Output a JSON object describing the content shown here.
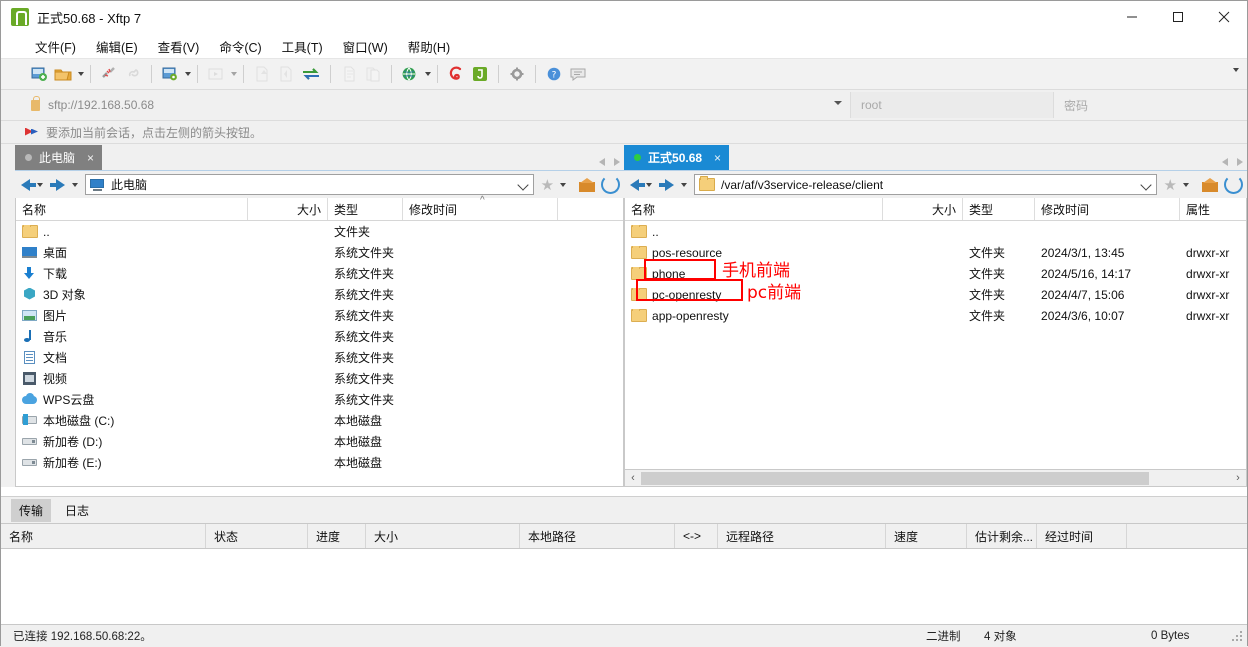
{
  "window": {
    "title": "正式50.68 - Xftp 7",
    "minimize": "—",
    "maximize": "▢",
    "close": "✕"
  },
  "menu": [
    "文件(F)",
    "编辑(E)",
    "查看(V)",
    "命令(C)",
    "工具(T)",
    "窗口(W)",
    "帮助(H)"
  ],
  "toolbar": {
    "icons": [
      "new-session-icon",
      "open-folder-icon",
      "disconnect-icon",
      "link-icon",
      "properties-icon",
      "run-icon",
      "transfer-left-icon",
      "transfer-right-icon",
      "sync-icon",
      "copy-icon",
      "paste-icon",
      "browser-icon",
      "xshell-icon",
      "xftp-icon",
      "settings-icon",
      "help-icon",
      "feedback-icon"
    ],
    "overflow": "chevron-down-icon"
  },
  "address": {
    "lock_icon": "lock-icon",
    "url": "sftp://192.168.50.68",
    "url_dropdown": "chevron-down-icon",
    "user_placeholder": "root",
    "password_placeholder": "密码"
  },
  "notice": {
    "icon": "arrows-icon",
    "text": "要添加当前会话，点击左侧的箭头按钮。"
  },
  "left_pane": {
    "tab": {
      "label": "此电脑",
      "close": "×",
      "dot": "status-dot"
    },
    "path": "此电脑",
    "path_icon": "pc-icon",
    "columns": [
      {
        "key": "name",
        "label": "名称"
      },
      {
        "key": "size",
        "label": "大小"
      },
      {
        "key": "type",
        "label": "类型"
      },
      {
        "key": "mtime",
        "label": "修改时间"
      }
    ],
    "sort_marker": "^",
    "rows": [
      {
        "icon": "folder-icon",
        "name": "..",
        "size": "",
        "type": "文件夹",
        "mtime": ""
      },
      {
        "icon": "desktop-icon",
        "name": "桌面",
        "size": "",
        "type": "系统文件夹",
        "mtime": ""
      },
      {
        "icon": "download-icon",
        "name": "下载",
        "size": "",
        "type": "系统文件夹",
        "mtime": ""
      },
      {
        "icon": "cube-icon",
        "name": "3D 对象",
        "size": "",
        "type": "系统文件夹",
        "mtime": ""
      },
      {
        "icon": "picture-icon",
        "name": "图片",
        "size": "",
        "type": "系统文件夹",
        "mtime": ""
      },
      {
        "icon": "music-icon",
        "name": "音乐",
        "size": "",
        "type": "系统文件夹",
        "mtime": ""
      },
      {
        "icon": "document-icon",
        "name": "文档",
        "size": "",
        "type": "系统文件夹",
        "mtime": ""
      },
      {
        "icon": "video-icon",
        "name": "视频",
        "size": "",
        "type": "系统文件夹",
        "mtime": ""
      },
      {
        "icon": "cloud-icon",
        "name": "WPS云盘",
        "size": "",
        "type": "系统文件夹",
        "mtime": ""
      },
      {
        "icon": "disk-c-icon",
        "name": "本地磁盘 (C:)",
        "size": "",
        "type": "本地磁盘",
        "mtime": ""
      },
      {
        "icon": "disk-icon",
        "name": "新加卷 (D:)",
        "size": "",
        "type": "本地磁盘",
        "mtime": ""
      },
      {
        "icon": "disk-icon",
        "name": "新加卷 (E:)",
        "size": "",
        "type": "本地磁盘",
        "mtime": ""
      }
    ]
  },
  "right_pane": {
    "tab": {
      "label": "正式50.68",
      "close": "×",
      "dot": "connected-dot"
    },
    "path": "/var/af/v3service-release/client",
    "path_icon": "folder-icon",
    "columns": [
      {
        "key": "name",
        "label": "名称"
      },
      {
        "key": "size",
        "label": "大小"
      },
      {
        "key": "type",
        "label": "类型"
      },
      {
        "key": "mtime",
        "label": "修改时间"
      },
      {
        "key": "attr",
        "label": "属性"
      }
    ],
    "rows": [
      {
        "icon": "folder-icon",
        "name": "..",
        "size": "",
        "type": "",
        "mtime": "",
        "attr": ""
      },
      {
        "icon": "folder-icon",
        "name": "pos-resource",
        "size": "",
        "type": "文件夹",
        "mtime": "2024/3/1, 13:45",
        "attr": "drwxr-xr"
      },
      {
        "icon": "folder-icon",
        "name": "phone",
        "size": "",
        "type": "文件夹",
        "mtime": "2024/5/16, 14:17",
        "attr": "drwxr-xr"
      },
      {
        "icon": "folder-icon",
        "name": "pc-openresty",
        "size": "",
        "type": "文件夹",
        "mtime": "2024/4/7, 15:06",
        "attr": "drwxr-xr"
      },
      {
        "icon": "folder-icon",
        "name": "app-openresty",
        "size": "",
        "type": "文件夹",
        "mtime": "2024/3/6, 10:07",
        "attr": "drwxr-xr"
      }
    ],
    "annotations": [
      {
        "label": "手机前端",
        "target": "phone"
      },
      {
        "label": "pc前端",
        "target": "pc-openresty"
      }
    ],
    "annotation_color": "#ff0000",
    "scroll_left": "‹",
    "scroll_right": "›"
  },
  "transfer_panel": {
    "tabs": [
      {
        "label": "传输",
        "selected": true
      },
      {
        "label": "日志",
        "selected": false
      }
    ],
    "columns": [
      "名称",
      "状态",
      "进度",
      "大小",
      "本地路径",
      "<->",
      "远程路径",
      "速度",
      "估计剩余...",
      "经过时间"
    ],
    "rows": []
  },
  "statusbar": {
    "connection": "已连接 192.168.50.68:22。",
    "mode": "二进制",
    "objects": "4 对象",
    "size": "0 Bytes"
  }
}
